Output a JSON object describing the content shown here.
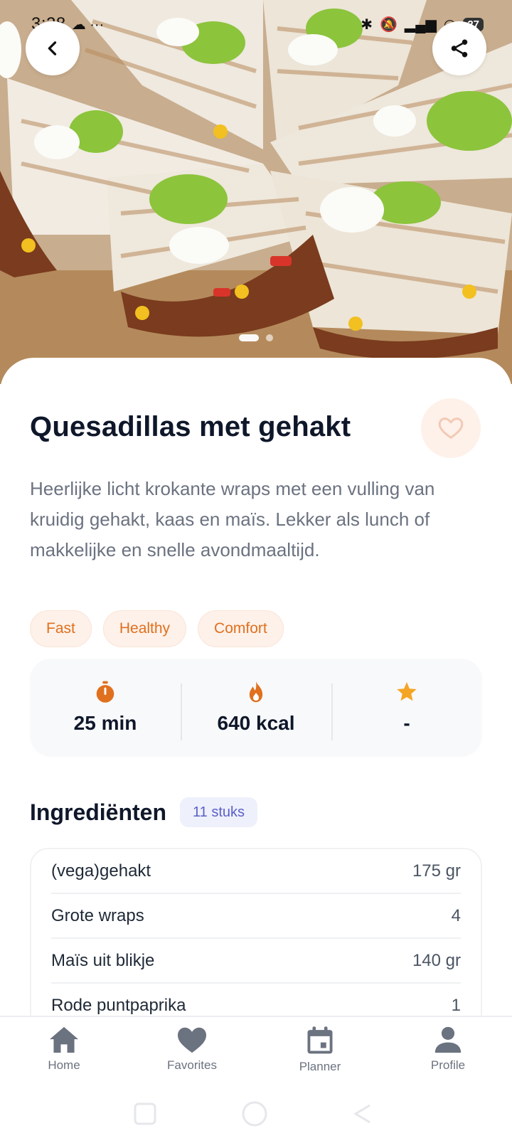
{
  "status_bar": {
    "time": "3:28",
    "left_icons": "☁ ···",
    "battery": "27"
  },
  "hero": {
    "page_count": 2,
    "active_index": 0
  },
  "recipe": {
    "title": "Quesadillas met gehakt",
    "description": "Heerlijke licht krokante wraps met een vulling van kruidig gehakt, kaas en maïs. Lekker als lunch of makkelijke en snelle avondmaaltijd.",
    "tags": [
      "Fast",
      "Healthy",
      "Comfort"
    ],
    "stats": {
      "time": "25 min",
      "calories": "640 kcal",
      "rating": "-"
    }
  },
  "ingredients": {
    "title": "Ingrediënten",
    "count_badge": "11 stuks",
    "items": [
      {
        "name": "(vega)gehakt",
        "amount": "175 gr"
      },
      {
        "name": "Grote wraps",
        "amount": "4"
      },
      {
        "name": "Maïs uit blikje",
        "amount": "140 gr"
      },
      {
        "name": "Rode puntpaprika",
        "amount": "1"
      }
    ]
  },
  "bottom_nav": {
    "home": "Home",
    "favorites": "Favorites",
    "planner": "Planner",
    "profile": "Profile"
  },
  "colors": {
    "accent": "#e0701e",
    "star": "#f5a524",
    "tag_bg": "#fdf1ea",
    "badge_text": "#5b5fc7"
  }
}
